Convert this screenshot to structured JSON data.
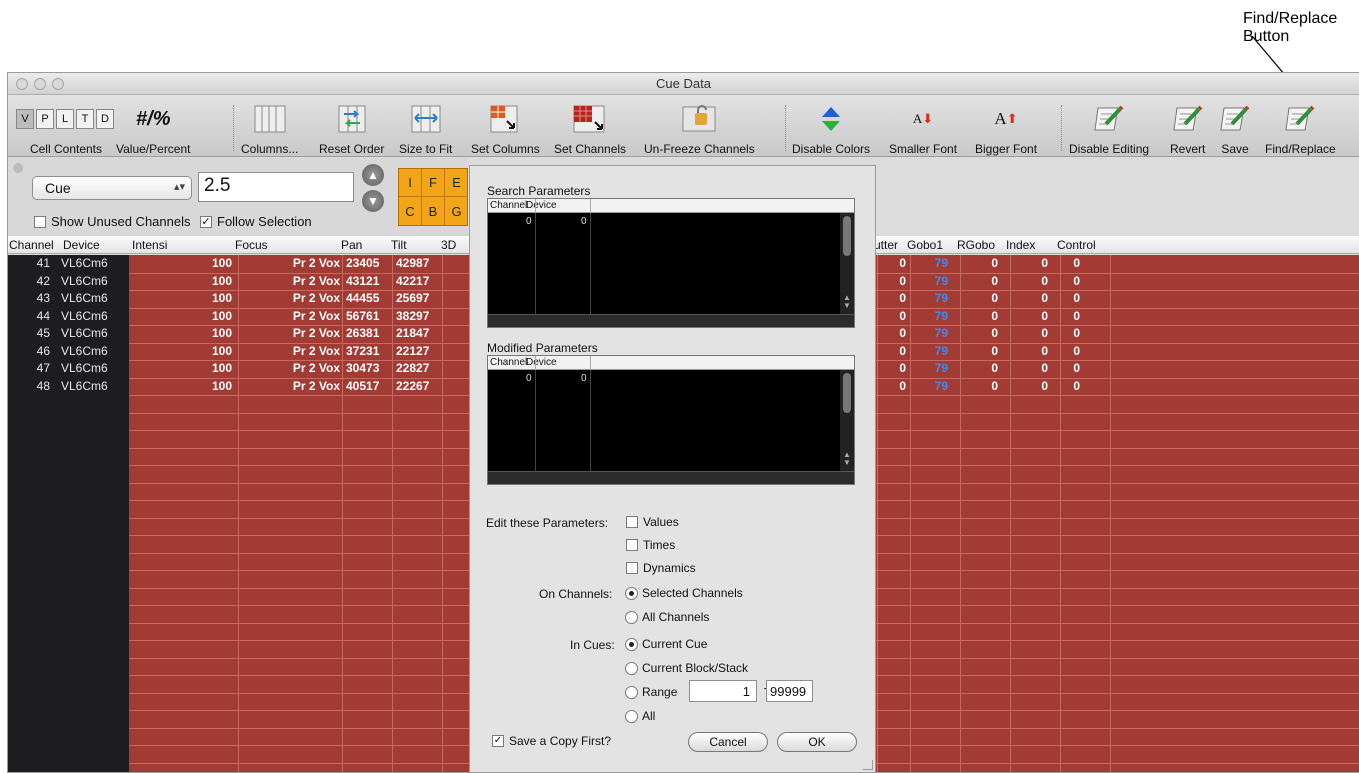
{
  "callout": {
    "label": "Find/Replace Button"
  },
  "window": {
    "title": "Cue Data"
  },
  "toolbar": {
    "vpltd": [
      "V",
      "P",
      "L",
      "T",
      "D"
    ],
    "value_percent_glyph": "#/%",
    "items": [
      {
        "label": "Cell Contents",
        "icon": "vpltd-icon"
      },
      {
        "label": "Value/Percent",
        "icon": "value-percent-icon"
      },
      {
        "label": "Columns...",
        "icon": "columns-icon"
      },
      {
        "label": "Reset Order",
        "icon": "reset-order-icon"
      },
      {
        "label": "Size to Fit",
        "icon": "size-to-fit-icon"
      },
      {
        "label": "Set Columns",
        "icon": "set-columns-icon"
      },
      {
        "label": "Set Channels",
        "icon": "set-channels-icon"
      },
      {
        "label": "Un-Freeze Channels",
        "icon": "unfreeze-icon"
      },
      {
        "label": "Disable Colors",
        "icon": "disable-colors-icon"
      },
      {
        "label": "Smaller Font",
        "icon": "smaller-font-icon"
      },
      {
        "label": "Bigger Font",
        "icon": "bigger-font-icon"
      },
      {
        "label": "Disable Editing",
        "icon": "disable-editing-icon"
      },
      {
        "label": "Revert",
        "icon": "revert-icon"
      },
      {
        "label": "Save",
        "icon": "save-icon"
      },
      {
        "label": "Find/Replace",
        "icon": "find-replace-icon"
      }
    ],
    "font_glyph": "A"
  },
  "controls": {
    "cue_select": "Cue",
    "cue_number": "2.5",
    "show_unused_label": "Show Unused Channels",
    "show_unused_checked": false,
    "follow_selection_label": "Follow Selection",
    "follow_selection_checked": true,
    "ife_grid": [
      "I",
      "F",
      "E",
      "C",
      "B",
      "G"
    ]
  },
  "columns": [
    "Channel",
    "Device",
    "Intensi",
    "Focus",
    "Pan",
    "Tilt",
    "3D",
    "utter",
    "Gobo1",
    "RGobo",
    "Index",
    "Control"
  ],
  "rows": [
    {
      "channel": "41",
      "device": "VL6Cm6",
      "intensity": "100",
      "focus": "Pr 2 Vox",
      "pan": "23405",
      "tilt": "42987",
      "shutter": "0",
      "gobo1": "79",
      "rgobo": "0",
      "index": "0",
      "control": "0"
    },
    {
      "channel": "42",
      "device": "VL6Cm6",
      "intensity": "100",
      "focus": "Pr 2 Vox",
      "pan": "43121",
      "tilt": "42217",
      "shutter": "0",
      "gobo1": "79",
      "rgobo": "0",
      "index": "0",
      "control": "0"
    },
    {
      "channel": "43",
      "device": "VL6Cm6",
      "intensity": "100",
      "focus": "Pr 2 Vox",
      "pan": "44455",
      "tilt": "25697",
      "shutter": "0",
      "gobo1": "79",
      "rgobo": "0",
      "index": "0",
      "control": "0"
    },
    {
      "channel": "44",
      "device": "VL6Cm6",
      "intensity": "100",
      "focus": "Pr 2 Vox",
      "pan": "56761",
      "tilt": "38297",
      "shutter": "0",
      "gobo1": "79",
      "rgobo": "0",
      "index": "0",
      "control": "0"
    },
    {
      "channel": "45",
      "device": "VL6Cm6",
      "intensity": "100",
      "focus": "Pr 2 Vox",
      "pan": "26381",
      "tilt": "21847",
      "shutter": "0",
      "gobo1": "79",
      "rgobo": "0",
      "index": "0",
      "control": "0"
    },
    {
      "channel": "46",
      "device": "VL6Cm6",
      "intensity": "100",
      "focus": "Pr 2 Vox",
      "pan": "37231",
      "tilt": "22127",
      "shutter": "0",
      "gobo1": "79",
      "rgobo": "0",
      "index": "0",
      "control": "0"
    },
    {
      "channel": "47",
      "device": "VL6Cm6",
      "intensity": "100",
      "focus": "Pr 2 Vox",
      "pan": "30473",
      "tilt": "22827",
      "shutter": "0",
      "gobo1": "79",
      "rgobo": "0",
      "index": "0",
      "control": "0"
    },
    {
      "channel": "48",
      "device": "VL6Cm6",
      "intensity": "100",
      "focus": "Pr 2 Vox",
      "pan": "40517",
      "tilt": "22267",
      "shutter": "0",
      "gobo1": "79",
      "rgobo": "0",
      "index": "0",
      "control": "0"
    }
  ],
  "dialog": {
    "search_title": "Search Parameters",
    "modified_title": "Modified Parameters",
    "table_headers": [
      "Channel",
      "Device"
    ],
    "search_values": [
      "0",
      "0"
    ],
    "modified_values": [
      "0",
      "0"
    ],
    "edit_label": "Edit these Parameters:",
    "edit_options": [
      {
        "label": "Values",
        "checked": false
      },
      {
        "label": "Times",
        "checked": false
      },
      {
        "label": "Dynamics",
        "checked": false
      }
    ],
    "channels_label": "On Channels:",
    "channel_options": [
      {
        "label": "Selected Channels",
        "selected": true
      },
      {
        "label": "All Channels",
        "selected": false
      }
    ],
    "cues_label": "In Cues:",
    "cue_options": [
      {
        "label": "Current Cue",
        "selected": true
      },
      {
        "label": "Current Block/Stack",
        "selected": false
      },
      {
        "label": "Range",
        "selected": false
      },
      {
        "label": "All",
        "selected": false
      }
    ],
    "range_from": "1",
    "range_to_label": "To",
    "range_to": "99999",
    "save_copy_label": "Save a Copy First?",
    "save_copy_checked": true,
    "cancel_label": "Cancel",
    "ok_label": "OK"
  },
  "colors": {
    "grid_red": "#a33b35",
    "grid_line": "#c86a60",
    "channel_strip": "#1d1d1f",
    "gobo_blue": "#3c8cf0",
    "ife_orange": "#f2a516"
  }
}
